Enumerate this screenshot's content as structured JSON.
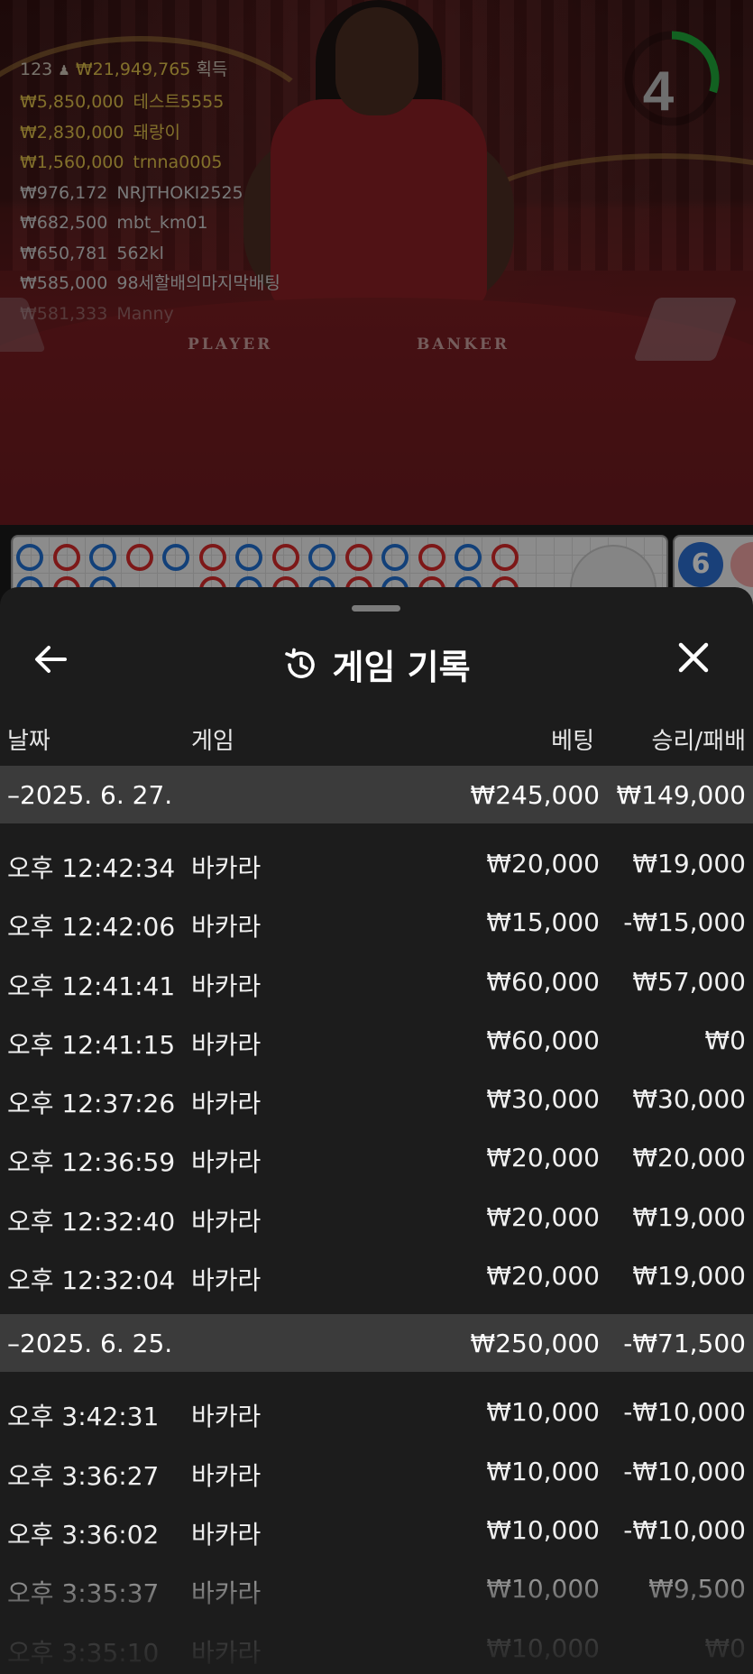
{
  "leaderboard": {
    "count": "123",
    "total": "₩21,949,765",
    "total_suffix": "획득",
    "entries": [
      {
        "amount": "₩5,850,000",
        "name": "테스트5555"
      },
      {
        "amount": "₩2,830,000",
        "name": "돼랑이"
      },
      {
        "amount": "₩1,560,000",
        "name": "trnna0005"
      },
      {
        "amount": "₩976,172",
        "name": "NRJTHOKI2525"
      },
      {
        "amount": "₩682,500",
        "name": "mbt_km01"
      },
      {
        "amount": "₩650,781",
        "name": "562kl"
      },
      {
        "amount": "₩585,000",
        "name": "98세할배의마지막배팅"
      },
      {
        "amount": "₩581,333",
        "name": "Manny"
      }
    ]
  },
  "table": {
    "player_label": "PLAYER",
    "banker_label": "BANKER"
  },
  "timer": {
    "value": "4",
    "progress": 0.3
  },
  "road": {
    "side_count": "6"
  },
  "sheet": {
    "title": "게임 기록",
    "columns": {
      "date": "날짜",
      "game": "게임",
      "bet": "베팅",
      "result": "승리/패배"
    },
    "groups": [
      {
        "date": "–2025. 6. 27.",
        "bet_total": "₩245,000",
        "result_total": "₩149,000",
        "rows": [
          {
            "time": "오후 12:42:34",
            "game": "바카라",
            "bet": "₩20,000",
            "result": "₩19,000"
          },
          {
            "time": "오후 12:42:06",
            "game": "바카라",
            "bet": "₩15,000",
            "result": "-₩15,000"
          },
          {
            "time": "오후 12:41:41",
            "game": "바카라",
            "bet": "₩60,000",
            "result": "₩57,000"
          },
          {
            "time": "오후 12:41:15",
            "game": "바카라",
            "bet": "₩60,000",
            "result": "₩0"
          },
          {
            "time": "오후 12:37:26",
            "game": "바카라",
            "bet": "₩30,000",
            "result": "₩30,000"
          },
          {
            "time": "오후 12:36:59",
            "game": "바카라",
            "bet": "₩20,000",
            "result": "₩20,000"
          },
          {
            "time": "오후 12:32:40",
            "game": "바카라",
            "bet": "₩20,000",
            "result": "₩19,000"
          },
          {
            "time": "오후 12:32:04",
            "game": "바카라",
            "bet": "₩20,000",
            "result": "₩19,000"
          }
        ]
      },
      {
        "date": "–2025. 6. 25.",
        "bet_total": "₩250,000",
        "result_total": "-₩71,500",
        "rows": [
          {
            "time": "오후 3:42:31",
            "game": "바카라",
            "bet": "₩10,000",
            "result": "-₩10,000"
          },
          {
            "time": "오후 3:36:27",
            "game": "바카라",
            "bet": "₩10,000",
            "result": "-₩10,000"
          },
          {
            "time": "오후 3:36:02",
            "game": "바카라",
            "bet": "₩10,000",
            "result": "-₩10,000"
          },
          {
            "time": "오후 3:35:37",
            "game": "바카라",
            "bet": "₩10,000",
            "result": "₩9,500"
          },
          {
            "time": "오후 3:35:10",
            "game": "바카라",
            "bet": "₩10,000",
            "result": "₩0"
          }
        ]
      }
    ]
  },
  "colors": {
    "gold": "#e0c14a",
    "player_blue": "#1f6fd1",
    "banker_red": "#d82a2a",
    "sheet_bg": "#1c1c1c",
    "date_row_bg": "#3b3b3b",
    "timer_green": "#1fa83a"
  },
  "icons": {
    "back": "arrow-left-icon",
    "close": "close-icon",
    "history": "history-icon",
    "timer": "timer-ring-icon"
  }
}
